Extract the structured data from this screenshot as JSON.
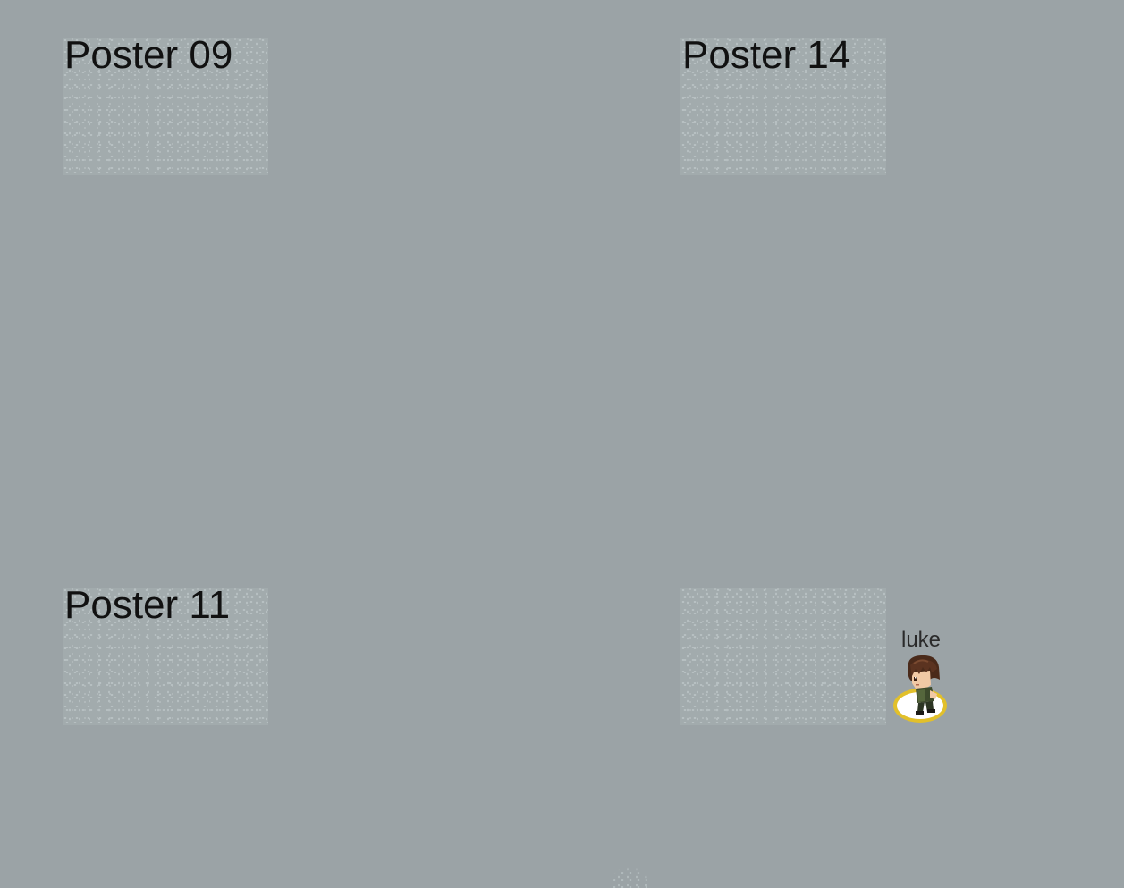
{
  "scene": {
    "background_color": "#9ba3a6",
    "posters": [
      {
        "label": "Poster 09"
      },
      {
        "label": "Poster 14"
      },
      {
        "label": "Poster 11"
      },
      {
        "label": ""
      }
    ]
  },
  "player": {
    "name": "luke",
    "ring_color": "#e2c02a"
  }
}
